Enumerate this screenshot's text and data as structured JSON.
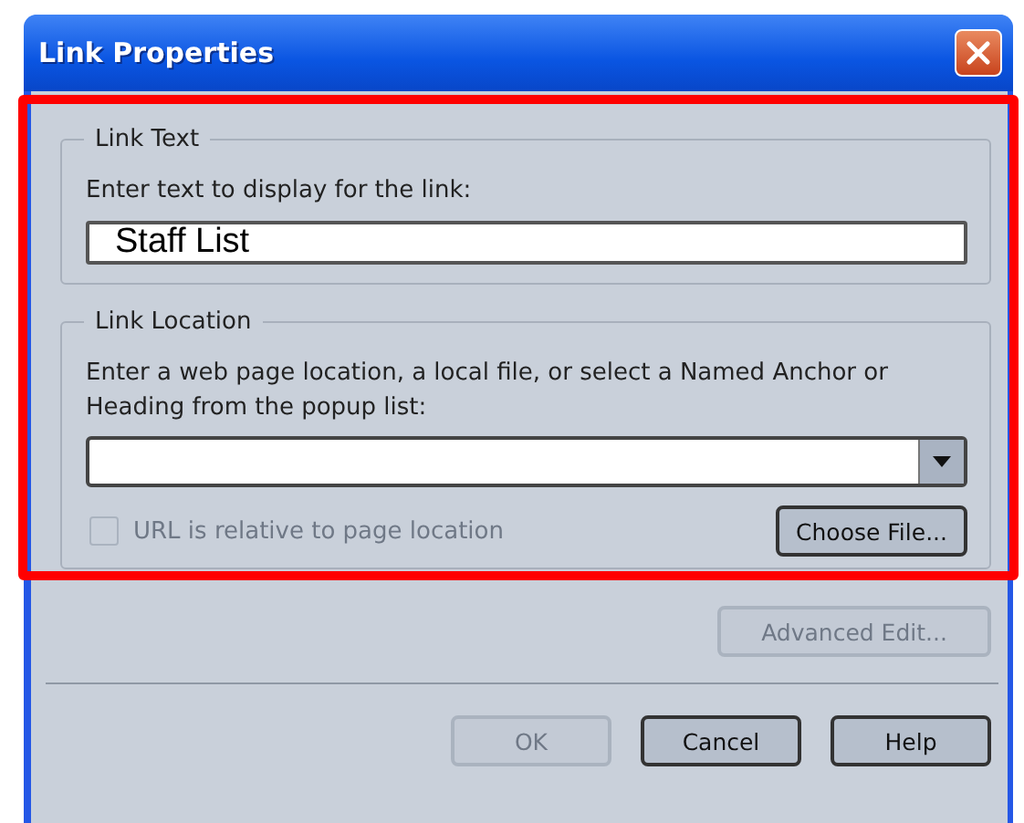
{
  "window": {
    "title": "Link Properties"
  },
  "link_text": {
    "legend": "Link Text",
    "label": "Enter text to display for the link:",
    "value": "Staff List"
  },
  "link_location": {
    "legend": "Link Location",
    "label": "Enter a web page location, a local file, or select a Named Anchor or Heading from the popup list:"
  },
  "relative_checkbox": {
    "label": "URL is relative to page location",
    "checked": false,
    "disabled": true
  },
  "choose_file": {
    "label": "Choose File...",
    "disabled": false
  },
  "advanced_edit": {
    "label": "Advanced Edit...",
    "disabled": true
  },
  "buttons": [
    {
      "label": "OK",
      "disabled": true
    },
    {
      "label": "Cancel",
      "disabled": false
    },
    {
      "label": "Help",
      "disabled": false
    }
  ]
}
